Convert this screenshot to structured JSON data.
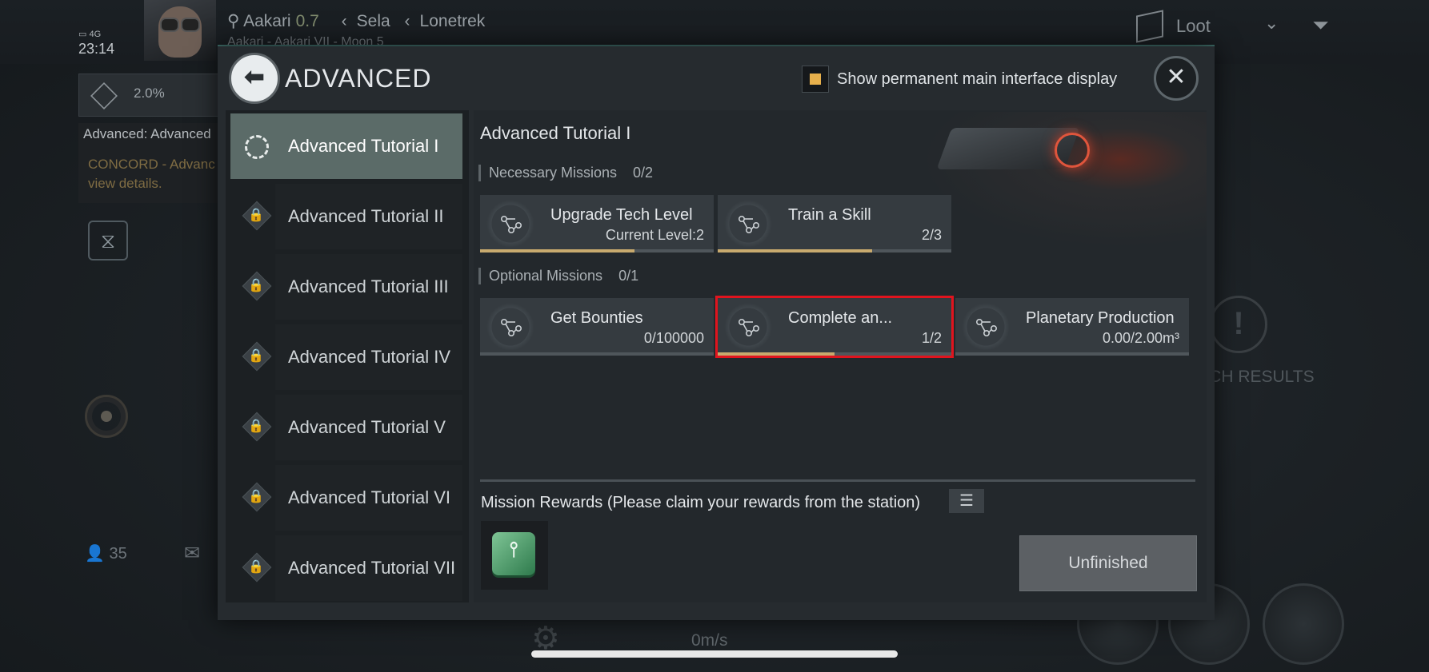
{
  "hud": {
    "network": "4G",
    "clock": "23:14",
    "location": {
      "system": "Aakari",
      "security": "0.7",
      "constellation": "Sela",
      "region": "Lonetrek",
      "sublocation": "Aakari - Aakari VII - Moon 5"
    },
    "loot_label": "Loot",
    "cargo_percent": "2.0%",
    "mission_tracker": {
      "title": "Advanced: Advanced",
      "body": "CONCORD - Advanc\nview details."
    },
    "people_count": "35",
    "search_results": "RCH RESULTS",
    "speed": "0m/s"
  },
  "modal": {
    "title": "ADVANCED",
    "show_permanent_label": "Show permanent main interface display",
    "show_permanent_checked": true,
    "sidebar": [
      {
        "label": "Advanced Tutorial I",
        "state": "active"
      },
      {
        "label": "Advanced Tutorial II",
        "state": "locked"
      },
      {
        "label": "Advanced Tutorial III",
        "state": "locked"
      },
      {
        "label": "Advanced Tutorial IV",
        "state": "locked"
      },
      {
        "label": "Advanced Tutorial V",
        "state": "locked"
      },
      {
        "label": "Advanced Tutorial VI",
        "state": "locked"
      },
      {
        "label": "Advanced Tutorial VII",
        "state": "locked"
      }
    ],
    "content": {
      "title": "Advanced Tutorial I",
      "necessary": {
        "label": "Necessary Missions",
        "count": "0/2",
        "missions": [
          {
            "name": "Upgrade Tech Level",
            "progress": "Current Level:2",
            "fill": 0.66
          },
          {
            "name": "Train a Skill",
            "progress": "2/3",
            "fill": 0.66
          }
        ]
      },
      "optional": {
        "label": "Optional Missions",
        "count": "0/1",
        "missions": [
          {
            "name": "Get Bounties",
            "progress": "0/100000",
            "fill": 0
          },
          {
            "name": "Complete an...",
            "progress": "1/2",
            "fill": 0.5,
            "selected": true
          },
          {
            "name": "Planetary Production",
            "progress": "0.00/2.00m³",
            "fill": 0
          }
        ]
      },
      "rewards_label": "Mission Rewards (Please claim your rewards from the station)",
      "status_button": "Unfinished"
    }
  },
  "colors": {
    "accent_gold": "#c8aa6e",
    "checkbox": "#e7b04c",
    "highlight": "#e0141e",
    "teal": "#3f6f6a"
  }
}
